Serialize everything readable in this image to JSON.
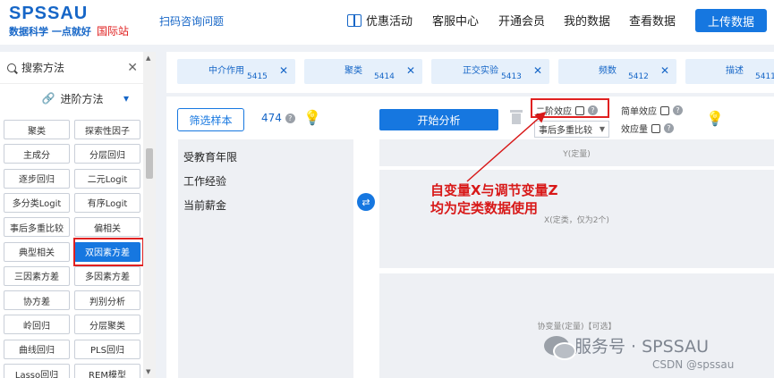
{
  "header": {
    "logo_main": "SPSSAU",
    "logo_sub": "数据科学 一点就好",
    "logo_intl": "国际站",
    "scan_link": "扫码咨询问题",
    "nav": [
      "优惠活动",
      "客服中心",
      "开通会员",
      "我的数据",
      "查看数据"
    ],
    "upload_label": "上传数据"
  },
  "sidebar": {
    "search_label": "搜索方法",
    "advanced_label": "进阶方法",
    "methods": [
      [
        "聚类",
        "探索性因子"
      ],
      [
        "主成分",
        "分层回归"
      ],
      [
        "逐步回归",
        "二元Logit"
      ],
      [
        "多分类Logit",
        "有序Logit"
      ],
      [
        "事后多重比较",
        "偏相关"
      ],
      [
        "典型相关",
        "双因素方差"
      ],
      [
        "三因素方差",
        "多因素方差"
      ],
      [
        "协方差",
        "判别分析"
      ],
      [
        "岭回归",
        "分层聚类"
      ],
      [
        "曲线回归",
        "PLS回归"
      ],
      [
        "Lasso回归",
        "REM模型"
      ]
    ],
    "active_method": "双因素方差"
  },
  "tags": [
    {
      "name": "中介作用",
      "count": "5415"
    },
    {
      "name": "聚类",
      "count": "5414"
    },
    {
      "name": "正交实验",
      "count": "5413"
    },
    {
      "name": "频数",
      "count": "5412"
    },
    {
      "name": "描述",
      "count": "5411"
    }
  ],
  "main": {
    "filter_label": "筛选样本",
    "sample_count": "474",
    "variables": [
      "受教育年限",
      "工作经验",
      "当前薪金"
    ],
    "start_label": "开始分析",
    "second_order_label": "二阶效应",
    "simple_effect_label": "简单效应",
    "effect_size_label": "效应量",
    "posthoc_select": "事后多重比较",
    "zone_y": "Y(定量)",
    "zone_x": "X(定类，仅为2个)",
    "zone_cov": "协变量(定量)【可选】"
  },
  "annotation": {
    "line1": "自变量X与调节变量Z",
    "line2": "均为定类数据使用"
  },
  "watermark": {
    "text": "服务号 · SPSSAU",
    "csdn": "CSDN @spssau"
  },
  "colors": {
    "brand": "#1677e0",
    "highlight": "#e02020"
  }
}
